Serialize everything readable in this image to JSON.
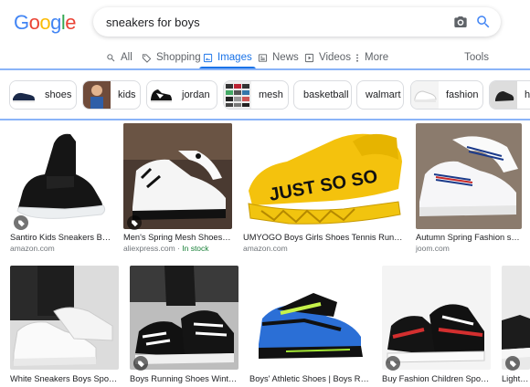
{
  "logo": {
    "text": "Google"
  },
  "search": {
    "query": "sneakers for boys"
  },
  "tabs": [
    {
      "label": "All",
      "icon": "search-icon"
    },
    {
      "label": "Shopping",
      "icon": "tag-icon"
    },
    {
      "label": "Images",
      "icon": "image-icon",
      "active": true
    },
    {
      "label": "News",
      "icon": "news-icon"
    },
    {
      "label": "Videos",
      "icon": "play-icon"
    },
    {
      "label": "More",
      "icon": "more-vert-icon"
    }
  ],
  "tools": {
    "label": "Tools"
  },
  "chips": [
    {
      "label": "shoes"
    },
    {
      "label": "kids"
    },
    {
      "label": "jordan"
    },
    {
      "label": "mesh"
    },
    {
      "label": "basketball"
    },
    {
      "label": "walmart"
    },
    {
      "label": "fashion"
    },
    {
      "label": "h"
    }
  ],
  "results": [
    {
      "title": "Santiro Kids Sneakers Boys...",
      "source": "amazon.com",
      "stock": ""
    },
    {
      "title": "Men's Spring Mesh Shoes Boys...",
      "source": "aliexpress.com",
      "stock": "In stock"
    },
    {
      "title": "UMYOGO Boys Girls Shoes Tennis Running ...",
      "source": "amazon.com",
      "stock": ""
    },
    {
      "title": "Autumn Spring Fashion sneak...",
      "source": "joom.com",
      "stock": ""
    },
    {
      "title": "White Sneakers Boys Sport S...",
      "source": "",
      "stock": ""
    },
    {
      "title": "Boys Running Shoes Winter M...",
      "source": "",
      "stock": ""
    },
    {
      "title": "Boys' Athletic Shoes | Boys Runni...",
      "source": "",
      "stock": ""
    },
    {
      "title": "Buy Fashion Children Sport S...",
      "source": "",
      "stock": ""
    },
    {
      "title": "Lightwei...",
      "source": "",
      "stock": ""
    }
  ],
  "shoe_text": "JUST SO SO",
  "colors": {
    "accent": "#1a73e8",
    "google_blue": "#4285f4",
    "google_red": "#ea4335",
    "google_yellow": "#fbbc05",
    "google_green": "#34a853",
    "in_stock": "#188038"
  }
}
